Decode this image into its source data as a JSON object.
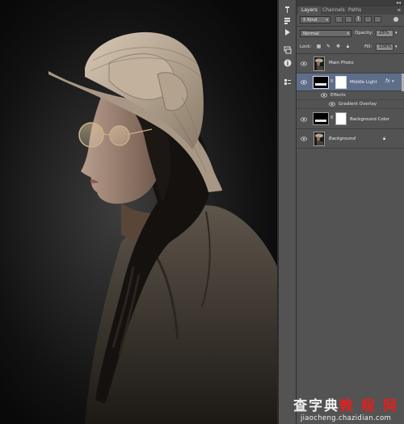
{
  "toolstrip": {
    "icons": [
      "brush-history-icon",
      "play-icon",
      "layers-stack-icon",
      "info-icon",
      "properties-icon"
    ]
  },
  "panel": {
    "tabs": [
      {
        "label": "Layers",
        "active": true
      },
      {
        "label": "Channels",
        "active": false
      },
      {
        "label": "Paths",
        "active": false
      }
    ],
    "filter_kind": "Kind",
    "blend_mode": "Normal",
    "opacity_label": "Opacity:",
    "opacity_value": "25%",
    "lock_label": "Lock:",
    "fill_label": "Fill:",
    "fill_value": "100%"
  },
  "layers": [
    {
      "name": "Main Photo",
      "thumb": "photo",
      "selected": false,
      "visible": true
    },
    {
      "name": "Middle Light",
      "thumb": "black-with-mask",
      "selected": true,
      "visible": true,
      "fx": "fx"
    },
    {
      "name": "Background Color",
      "thumb": "black-with-mask",
      "selected": false,
      "visible": true
    },
    {
      "name": "Background",
      "thumb": "photo",
      "selected": false,
      "visible": true,
      "locked": true
    }
  ],
  "effects": {
    "label": "Effects",
    "items": [
      "Gradient Overlay"
    ]
  },
  "watermark": {
    "cn_main_1": "查字典",
    "cn_main_2": "教 程 网",
    "url": "jiaocheng.chazidian.com"
  },
  "colors": {
    "panel_bg": "#535353",
    "selected_layer": "#5e6e8a",
    "watermark_red": "#e02020"
  }
}
